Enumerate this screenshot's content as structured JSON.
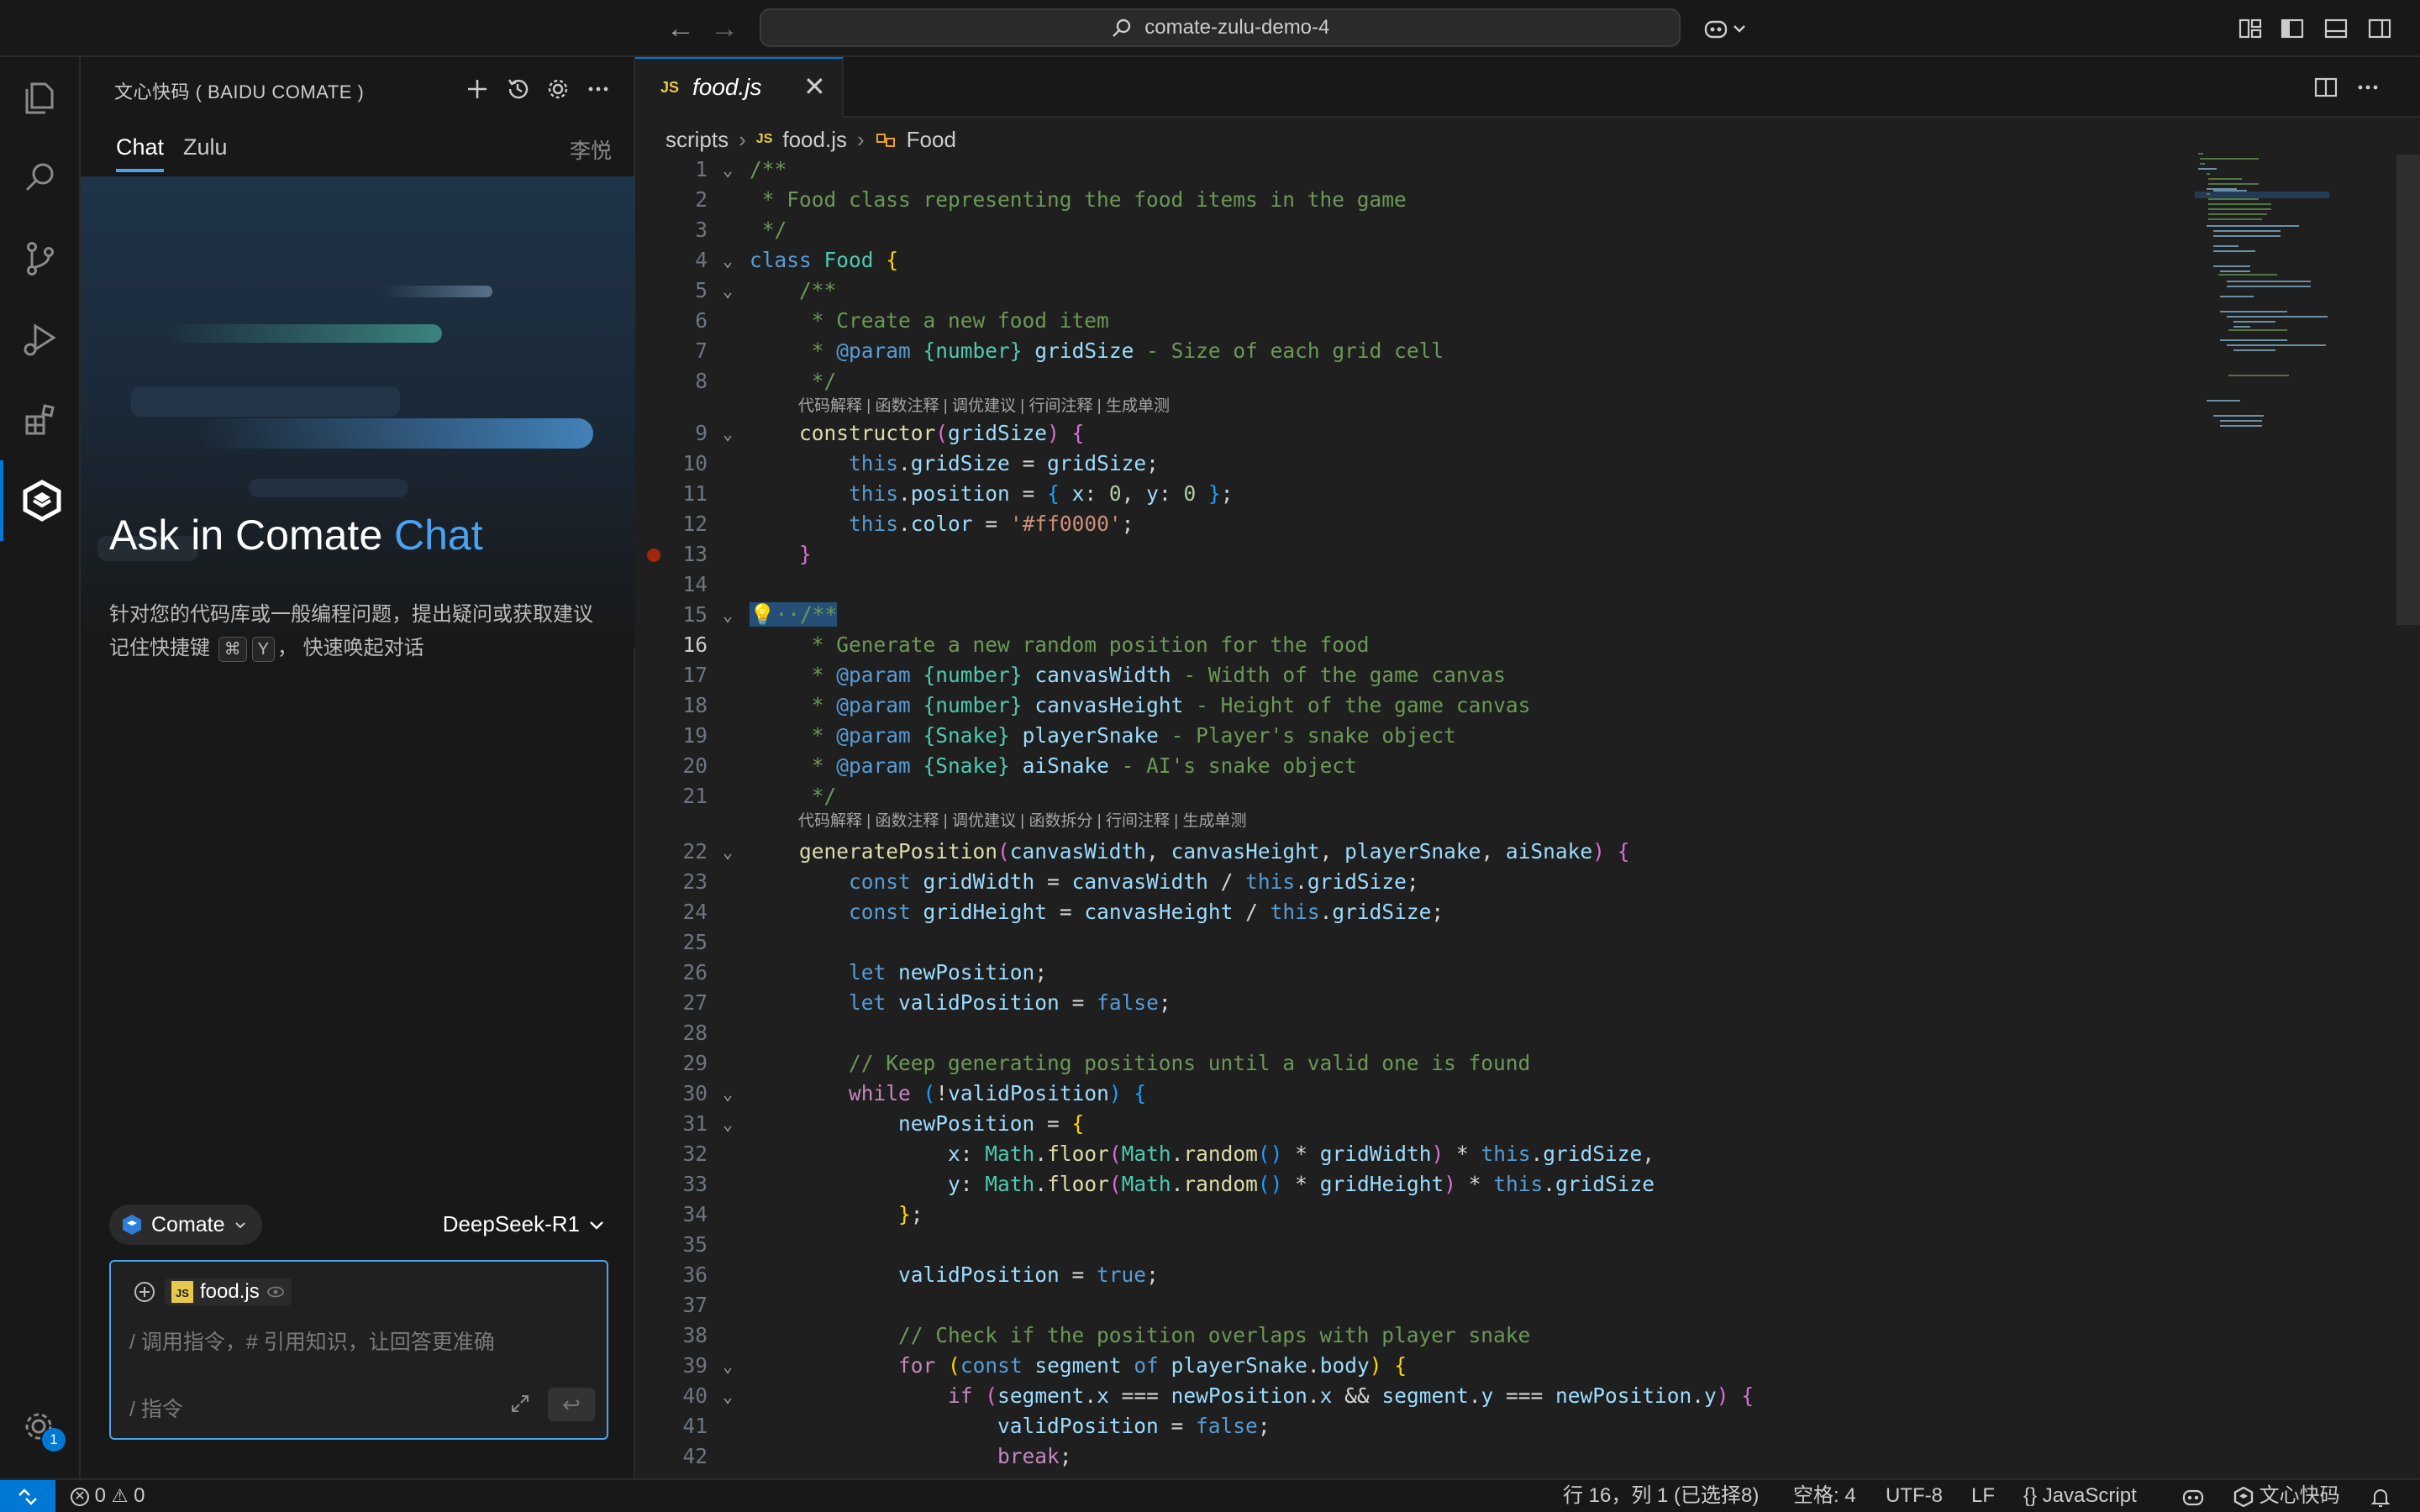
{
  "titlebar": {
    "search_text": "comate-zulu-demo-4",
    "back_glyph": "←",
    "forward_glyph": "→"
  },
  "sidebar": {
    "title": "文心快码 ( BAIDU COMATE )",
    "tabs": [
      "Chat",
      "Zulu"
    ],
    "user_name": "李悦",
    "hero_title_prefix": "Ask in Comate ",
    "hero_title_accent": "Chat",
    "hero_desc_line1": "针对您的代码库或一般编程问题，提出疑问或获取建议",
    "hero_desc_line2_prefix": "记住快捷键",
    "hero_key1": "⌘",
    "hero_key2": "Y",
    "hero_desc_line2_suffix": "， 快速唤起对话",
    "agent_label": "Comate",
    "model_label": "DeepSeek-R1",
    "context_file": "food.js",
    "input_placeholder": "/ 调用指令，# 引用知识，让回答更准确",
    "command_hint": "/ 指令",
    "send_glyph": "↩"
  },
  "editor": {
    "tab_name": "food.js",
    "tab_close": "✕",
    "breadcrumb": [
      "scripts",
      "food.js",
      "Food"
    ],
    "js_badge": "JS",
    "codelens_1": "代码解释 | 函数注释 | 调优建议 | 行间注释 | 生成单测",
    "codelens_2": "代码解释 | 函数注释 | 调优建议 | 函数拆分 | 行间注释 | 生成单测",
    "current_line": 16,
    "breakpoint_line": 13
  },
  "statusbar": {
    "errors": "0",
    "warnings": "0",
    "position": "行 16，列 1 (已选择8)",
    "spaces": "空格: 4",
    "encoding": "UTF-8",
    "eol": "LF",
    "language": "JavaScript",
    "plugin": "文心快码",
    "badge_count": "1"
  },
  "colors": {
    "accent": "#0078d4",
    "chat_accent": "#4aa3f0",
    "breakpoint": "#a1260d"
  }
}
